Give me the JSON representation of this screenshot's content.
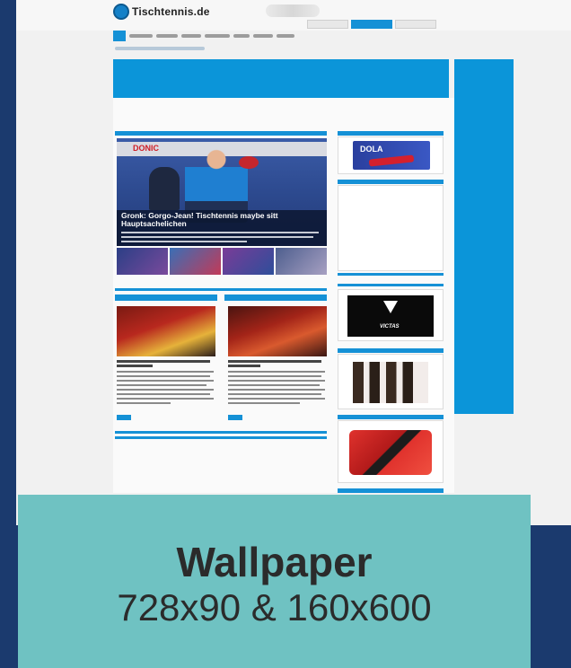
{
  "site": {
    "logo_text": "Tischtennis.de",
    "colors": {
      "brand": "#1591d6",
      "ad_blue": "#0b95d9",
      "background": "#1b3a6e",
      "caption_bg": "#6fc2c2"
    }
  },
  "hero": {
    "banner_text": "DONIC",
    "title": "Gronk: Gorgo-Jean! Tischtennis maybe sitt Hauptsachelichen"
  },
  "sidebar": {
    "ad_brand_1": "DOLA",
    "ad_brand_2": "VICTAS"
  },
  "caption": {
    "title": "Wallpaper",
    "subtitle": "728x90 & 160x600"
  }
}
